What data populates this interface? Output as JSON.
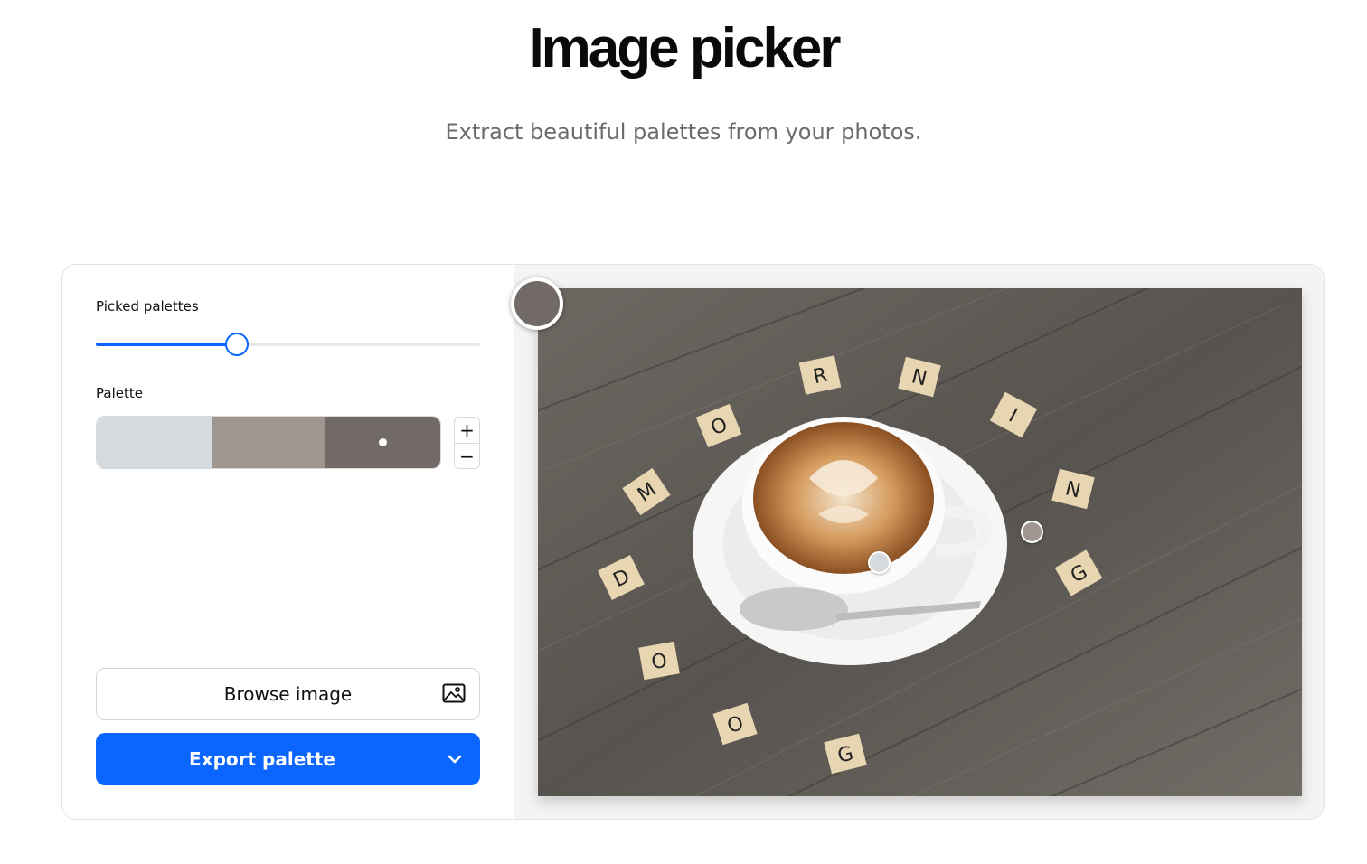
{
  "header": {
    "title": "Image picker",
    "subtitle": "Extract beautiful palettes from your photos."
  },
  "controls": {
    "picked_palettes_label": "Picked palettes",
    "slider_value_fraction": 0.367,
    "palette_label": "Palette",
    "palette_colors": [
      "#d4dadd",
      "#9f9690",
      "#726a66"
    ],
    "selected_swatch_index": 2,
    "stepper_plus": "+",
    "stepper_minus": "−",
    "browse_label": "Browse image",
    "browse_icon": "image-icon",
    "export_label": "Export palette",
    "export_dropdown_icon": "chevron-down-icon"
  },
  "colors": {
    "accent": "#0a66ff",
    "active_picker": "#726a66",
    "picker_2": "#9f9690",
    "picker_3": "#d4dadd"
  },
  "photo": {
    "subject": "latte-with-letter-tiles",
    "tile_letters": [
      "R",
      "N",
      "O",
      "I",
      "M",
      "N",
      "D",
      "G",
      "O",
      "O",
      "G"
    ]
  }
}
